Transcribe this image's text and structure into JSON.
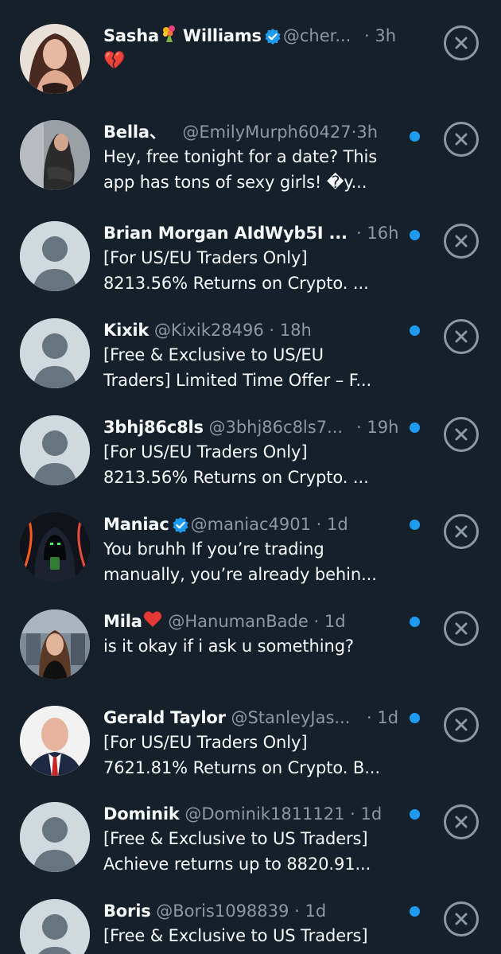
{
  "colors": {
    "background": "#15202b",
    "text_primary": "#f7f9f9",
    "text_secondary": "#8b98a5",
    "accent_blue": "#1d9bf0"
  },
  "requests": [
    {
      "name": "Sasha",
      "name_suffix": "Williams",
      "name_emoji": "flower-bouquet-emoji",
      "verified": true,
      "handle": "@cher...",
      "sep": "·",
      "time": "3h",
      "lines": [
        "💔"
      ],
      "unread": false,
      "avatar": "photo-woman-dark-hair"
    },
    {
      "name": "Bella、",
      "verified": false,
      "handle": "@EmilyMurph60427",
      "sep": "·",
      "time": "3h",
      "lines": [
        "Hey, free tonight for a date? This",
        "app has tons of sexy girls! �y..."
      ],
      "unread": true,
      "avatar": "photo-woman-mirror"
    },
    {
      "name": "Brian Morgan AIdWyb5I ...",
      "verified": false,
      "handle": "",
      "sep": "·",
      "time": "16h",
      "lines": [
        "[For US/EU Traders Only]",
        "8213.56% Returns on Crypto. ..."
      ],
      "unread": true,
      "avatar": "default-avatar"
    },
    {
      "name": "Kixik",
      "verified": false,
      "handle": "@Kixik28496",
      "sep": "·",
      "time": "18h",
      "lines": [
        "[Free & Exclusive to US/EU",
        "Traders] Limited Time Offer – F..."
      ],
      "unread": true,
      "avatar": "default-avatar"
    },
    {
      "name": "3bhj86c8ls",
      "verified": false,
      "handle": "@3bhj86c8ls7...",
      "sep": "·",
      "time": "19h",
      "lines": [
        "[For US/EU Traders Only]",
        "8213.56% Returns on Crypto. ..."
      ],
      "unread": true,
      "avatar": "default-avatar"
    },
    {
      "name": "Maniac",
      "verified": true,
      "handle": "@maniac4901",
      "sep": "·",
      "time": "1d",
      "lines": [
        "You bruhh  If you’re trading",
        "manually, you’re already behin..."
      ],
      "unread": true,
      "avatar": "hooded-figure-illustration"
    },
    {
      "name": "Mila",
      "name_emoji": "red-heart-emoji",
      "verified": false,
      "handle": "@HanumanBade",
      "sep": "·",
      "time": "1d",
      "lines": [
        "is it okay if i ask u something?"
      ],
      "unread": true,
      "avatar": "photo-woman-selfie"
    },
    {
      "name": "Gerald Taylor",
      "verified": false,
      "handle": "@StanleyJas...",
      "sep": "·",
      "time": "1d",
      "lines": [
        "[For US/EU Traders Only]",
        "7621.81% Returns on Crypto. B..."
      ],
      "unread": true,
      "avatar": "photo-man-suit"
    },
    {
      "name": "Dominik",
      "verified": false,
      "handle": "@Dominik1811121",
      "sep": "·",
      "time": "1d",
      "lines": [
        "[Free & Exclusive to US Traders]",
        "Achieve returns up to 8820.91..."
      ],
      "unread": true,
      "avatar": "default-avatar"
    },
    {
      "name": "Boris",
      "verified": false,
      "handle": "@Boris1098839",
      "sep": "·",
      "time": "1d",
      "lines": [
        "[Free & Exclusive to US Traders]"
      ],
      "unread": true,
      "avatar": "default-avatar"
    }
  ]
}
